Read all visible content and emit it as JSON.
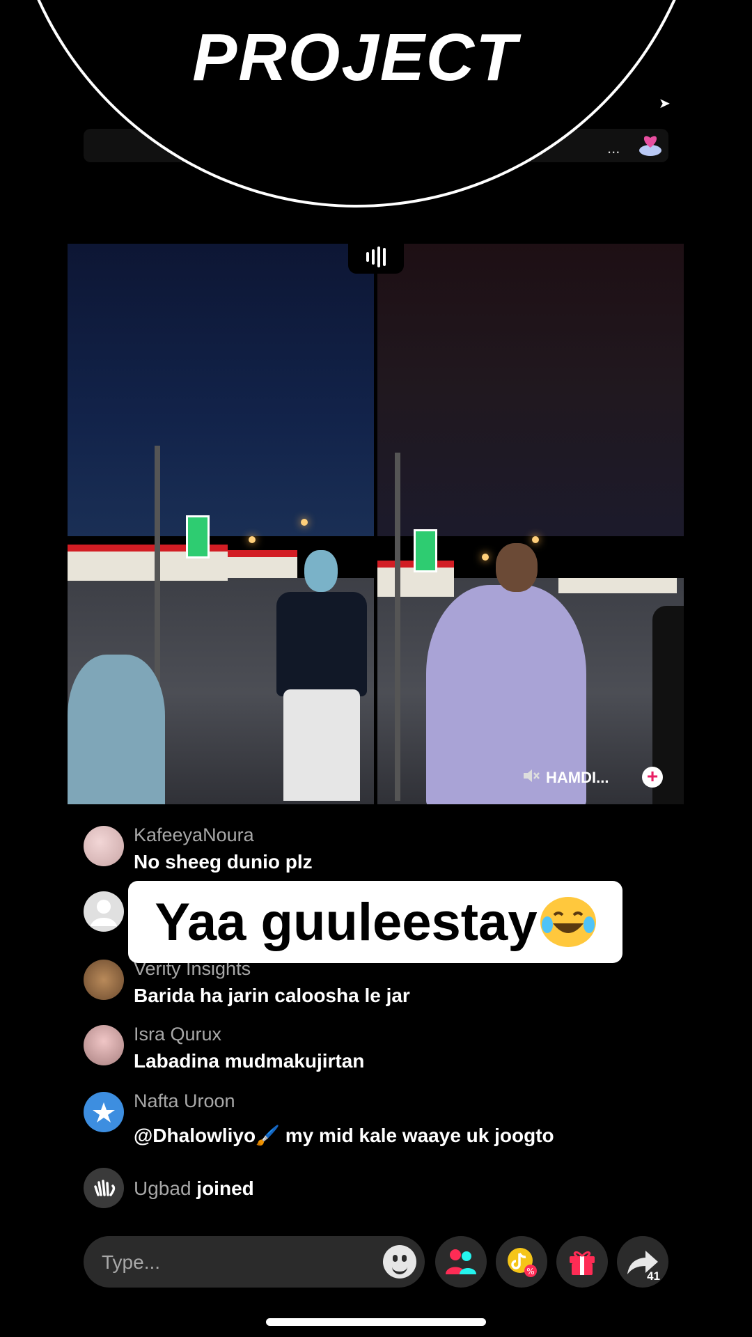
{
  "header": {
    "logo_text": "PROJECT",
    "more_label": "..."
  },
  "video": {
    "guest_name": "HAMDI...",
    "add_label": "+"
  },
  "comments": [
    {
      "user": "KafeeyaNoura",
      "text": "No sheeg dunio plz"
    },
    {
      "user": "Verity Insights",
      "text": "Barida ha jarin caloosha le jar"
    },
    {
      "user": "Isra Qurux",
      "text": "Labadina mudmakujirtan"
    },
    {
      "user": "Nafta Uroon",
      "text": "@Dhalowliyo🖌️ my mid kale waaye uk joogto"
    }
  ],
  "caption": {
    "text": "Yaa guuleestay"
  },
  "joined": {
    "user": "Ugbad",
    "word": "joined"
  },
  "input": {
    "placeholder": "Type..."
  },
  "actions": {
    "share_count": "41"
  },
  "colors": {
    "background": "#000000",
    "input_bg": "#2b2b2b",
    "username": "#a8a8a8",
    "accent_pink": "#fe2c55",
    "accent_cyan": "#25f4ee",
    "emoji_yellow": "#ffc83d"
  },
  "icons": [
    "audio-bars-icon",
    "heart-cloud-icon",
    "mute-icon",
    "plus-icon",
    "emoji-icon",
    "guests-icon",
    "promo-coin-icon",
    "gift-icon",
    "share-icon",
    "wave-hand-icon"
  ]
}
